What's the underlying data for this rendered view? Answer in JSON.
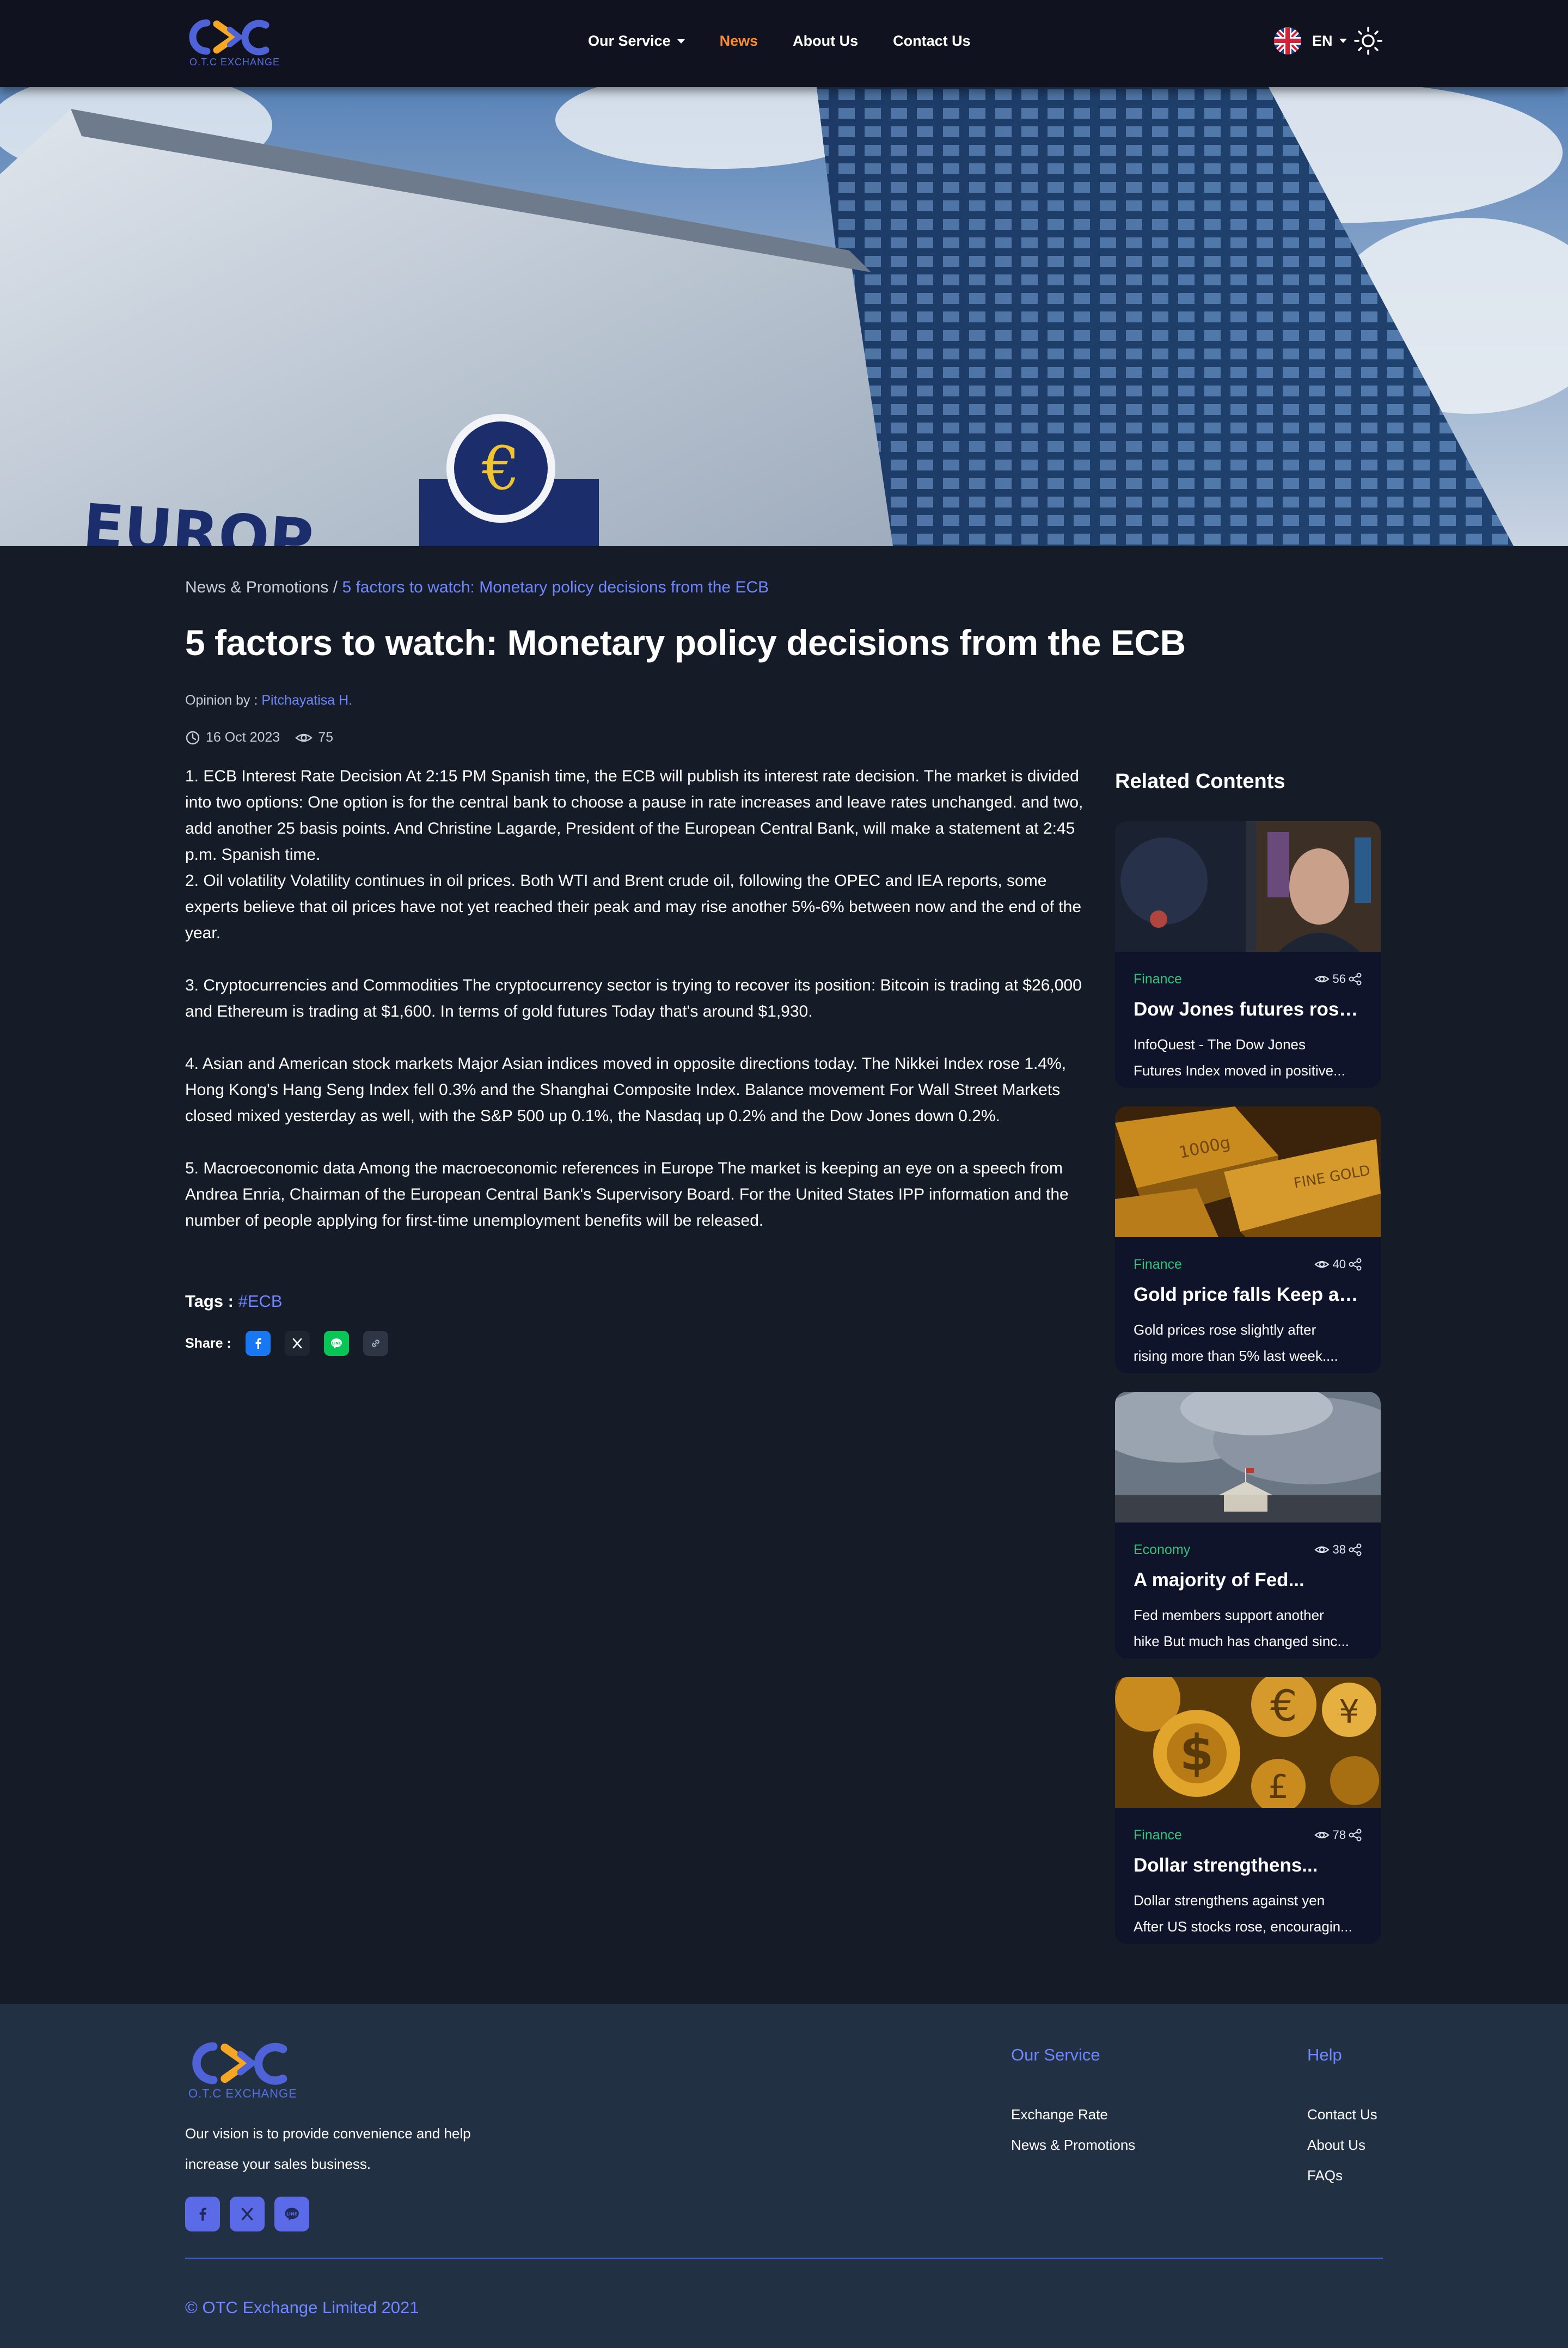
{
  "header": {
    "logo_text": "O.T.C EXCHANGE",
    "nav": [
      {
        "label": "Our Service"
      },
      {
        "label": "News"
      },
      {
        "label": "About Us"
      },
      {
        "label": "Contact Us"
      }
    ],
    "language": "EN",
    "accent_color": "#ff8a2a"
  },
  "hero": {
    "sign_text": "EUROP"
  },
  "article": {
    "breadcrumb_parent": "News & Promotions",
    "breadcrumb_separator": " / ",
    "breadcrumb_current": "5 factors to watch: Monetary policy decisions from the ECB",
    "title": "5 factors to watch: Monetary policy decisions from the ECB",
    "opinion_label": "Opinion by : ",
    "author": "Pitchayatisa H.",
    "date": "16 Oct 2023",
    "views": "75",
    "paragraphs": [
      "1. ECB Interest Rate Decision At 2:15 PM Spanish time, the ECB will publish its interest rate decision. The market is divided into two options: One option is for the central bank to choose a pause in rate increases and leave rates unchanged. and two, add another 25 basis points. And Christine Lagarde, President of the European Central Bank, will make a statement at 2:45 p.m. Spanish time.",
      "2. Oil volatility Volatility continues in oil prices. Both WTI and Brent crude oil, following the OPEC and IEA reports, some experts believe that oil prices have not yet reached their peak and may rise another 5%-6% between now and the end of the year.",
      "3. Cryptocurrencies and Commodities The cryptocurrency sector is trying to recover its position: Bitcoin is trading at $26,000 and Ethereum is trading at $1,600. In terms of gold futures Today that's around $1,930.",
      "4. Asian and American stock markets Major Asian indices moved in opposite directions today. The Nikkei Index rose 1.4%, Hong Kong's Hang Seng Index fell 0.3% and the Shanghai Composite Index. Balance movement For Wall Street Markets closed mixed yesterday as well, with the S&P 500 up 0.1%, the Nasdaq up 0.2% and the Dow Jones down 0.2%.",
      "5. Macroeconomic data Among the macroeconomic references in Europe The market is keeping an eye on a speech from Andrea Enria, Chairman of the European Central Bank's Supervisory Board. For the United States IPP information and the number of people applying for first-time unemployment benefits will be released."
    ],
    "tags_label": "Tags : ",
    "tag": "#ECB",
    "share_label": "Share :"
  },
  "related": {
    "heading": "Related Contents",
    "items": [
      {
        "category": "Finance",
        "views": "56",
        "title": "Dow Jones futures rose...",
        "desc_line1": "InfoQuest - The Dow Jones",
        "desc_line2": "Futures Index moved in positive..."
      },
      {
        "category": "Finance",
        "views": "40",
        "title": "Gold price falls Keep an...",
        "desc_line1": "Gold prices rose slightly after",
        "desc_line2": "rising more than 5% last week...."
      },
      {
        "category": "Economy",
        "views": "38",
        "title": "A majority of Fed...",
        "desc_line1": "Fed members support another",
        "desc_line2": "hike But much has changed sinc..."
      },
      {
        "category": "Finance",
        "views": "78",
        "title": "Dollar strengthens...",
        "desc_line1": "Dollar strengthens against yen",
        "desc_line2": "After US stocks rose, encouragin..."
      }
    ],
    "category_color": "#2fc57a"
  },
  "footer": {
    "logo_text": "O.T.C EXCHANGE",
    "vision_line1": "Our vision is to provide convenience and help",
    "vision_line2": "increase your sales business.",
    "col1": {
      "heading": "Our Service",
      "links": [
        "Exchange Rate",
        "News & Promotions"
      ]
    },
    "col2": {
      "heading": "Help",
      "links": [
        "Contact Us",
        "About Us",
        "FAQs"
      ]
    },
    "copyright": "© OTC Exchange Limited 2021",
    "link_color": "#6e86ff"
  }
}
